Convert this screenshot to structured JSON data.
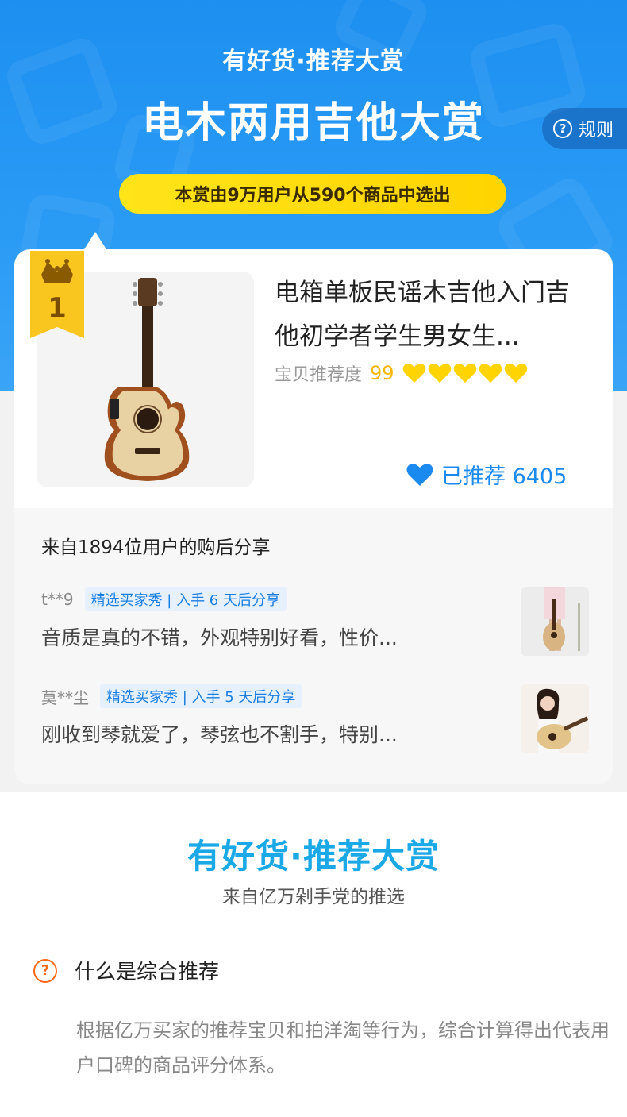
{
  "header": {
    "brand": "有好货·推荐大赏",
    "title": "电木两用吉他大赏",
    "rules_label": "规则",
    "selection_note": "本赏由9万用户从590个商品中选出"
  },
  "product": {
    "rank": "1",
    "title": "电箱单板民谣木吉他入门吉他初学者学生男女生...",
    "rating_label": "宝贝推荐度",
    "rating_score": "99",
    "hearts": 5,
    "recommended_label": "已推荐 6405"
  },
  "reviews": {
    "heading": "来自1894位用户的购后分享",
    "items": [
      {
        "user": "t**9",
        "tag": "精选买家秀 | 入手 6 天后分享",
        "text": "音质是真的不错，外观特别好看，性价..."
      },
      {
        "user": "莫**尘",
        "tag": "精选买家秀 | 入手 5 天后分享",
        "text": "刚收到琴就爱了，琴弦也不割手，特别..."
      }
    ]
  },
  "footer": {
    "brand": "有好货·推荐大赏",
    "subtitle": "来自亿万剁手党的推选",
    "faq_title": "什么是综合推荐",
    "faq_body": "根据亿万买家的推荐宝贝和拍洋淘等行为，综合计算得出代表用户口碑的商品评分体系。"
  },
  "colors": {
    "hero_blue": "#1d8ff0",
    "pill_yellow": "#ffd400",
    "accent_blue": "#1a8af0",
    "score_gold": "#f5b800",
    "faq_orange": "#ff6a1a"
  },
  "icons": [
    "crown-icon",
    "heart-icon",
    "question-icon",
    "guitar-image"
  ]
}
